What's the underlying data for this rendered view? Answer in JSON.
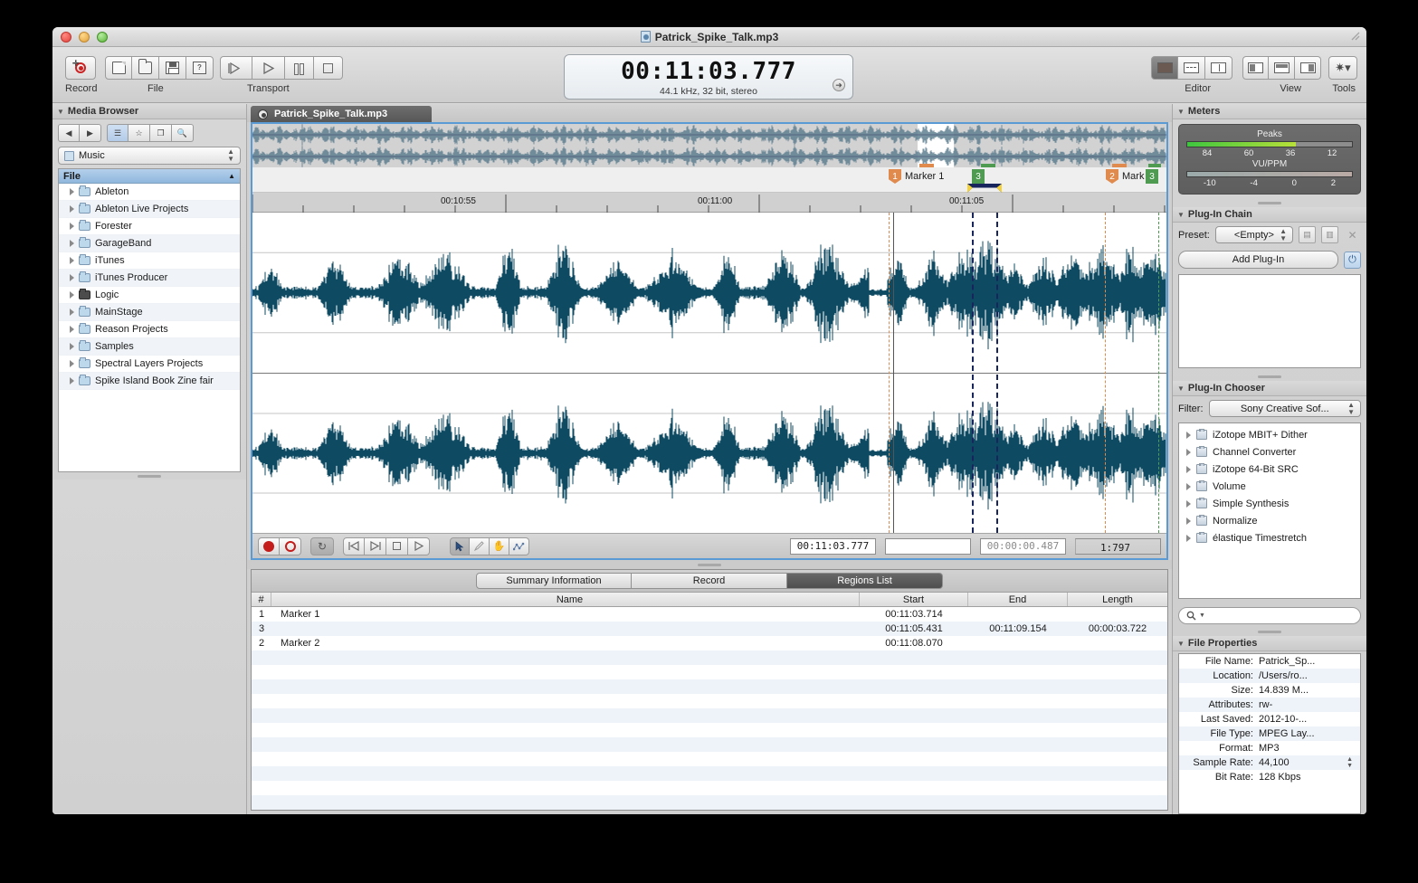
{
  "window": {
    "title": "Patrick_Spike_Talk.mp3"
  },
  "toolbar": {
    "groups": [
      {
        "label": "Record"
      },
      {
        "label": "File"
      },
      {
        "label": "Transport"
      },
      {
        "label": "Editor"
      },
      {
        "label": "View"
      },
      {
        "label": "Tools"
      }
    ],
    "record_label": "Record",
    "file_label": "File",
    "transport_label": "Transport",
    "editor_label": "Editor",
    "view_label": "View",
    "tools_label": "Tools"
  },
  "clock": {
    "time": "00:11:03.777",
    "format": "44.1 kHz, 32 bit, stereo"
  },
  "media_browser": {
    "title": "Media Browser",
    "path": "Music",
    "column_header": "File",
    "items": [
      {
        "label": "Ableton",
        "icon": "folder-icon"
      },
      {
        "label": "Ableton Live Projects",
        "icon": "folder-icon"
      },
      {
        "label": "Forester",
        "icon": "folder-icon"
      },
      {
        "label": "GarageBand",
        "icon": "folder-icon"
      },
      {
        "label": "iTunes",
        "icon": "folder-icon"
      },
      {
        "label": "iTunes Producer",
        "icon": "folder-icon"
      },
      {
        "label": "Logic",
        "icon": "folder-dark-icon"
      },
      {
        "label": "MainStage",
        "icon": "folder-icon"
      },
      {
        "label": "Reason Projects",
        "icon": "folder-icon"
      },
      {
        "label": "Samples",
        "icon": "folder-icon"
      },
      {
        "label": "Spectral Layers Projects",
        "icon": "folder-icon"
      },
      {
        "label": "Spike Island Book Zine fair",
        "icon": "folder-icon"
      }
    ]
  },
  "editor": {
    "tab_label": "Patrick_Spike_Talk.mp3",
    "ruler_labels": [
      "00:10:55",
      "00:11:00",
      "00:11:05"
    ],
    "markers": [
      {
        "number": "1",
        "label": "Marker 1",
        "color": "#e08a4e"
      },
      {
        "number": "3",
        "label": "",
        "color": "#4f9b52"
      },
      {
        "number": "2",
        "label": "Mark",
        "color": "#e08a4e"
      },
      {
        "number": "3",
        "label": "",
        "color": "#4f9b52"
      }
    ],
    "waveform_color": "#0f4a63"
  },
  "transport_fields": {
    "position": "00:11:03.777",
    "second": "",
    "selection": "00:00:00.487",
    "ratio": "1:797"
  },
  "bottom_tabs": [
    {
      "label": "Summary Information",
      "selected": false
    },
    {
      "label": "Record",
      "selected": false
    },
    {
      "label": "Regions List",
      "selected": true
    }
  ],
  "regions_list": {
    "columns": [
      "#",
      "Name",
      "Start",
      "End",
      "Length"
    ],
    "rows": [
      {
        "num": "1",
        "name": "Marker 1",
        "start": "00:11:03.714",
        "end": "",
        "length": ""
      },
      {
        "num": "3",
        "name": "",
        "start": "00:11:05.431",
        "end": "00:11:09.154",
        "length": "00:00:03.722"
      },
      {
        "num": "2",
        "name": "Marker 2",
        "start": "00:11:08.070",
        "end": "",
        "length": ""
      }
    ]
  },
  "meters": {
    "title": "Meters",
    "peaks_label": "Peaks",
    "peaks_ticks": [
      "84",
      "60",
      "36",
      "12"
    ],
    "vu_label": "VU/PPM",
    "vu_ticks": [
      "-10",
      "-4",
      "0",
      "2"
    ]
  },
  "plugin_chain": {
    "title": "Plug-In Chain",
    "preset_label": "Preset:",
    "preset_value": "<Empty>",
    "add_label": "Add Plug-In"
  },
  "plugin_chooser": {
    "title": "Plug-In Chooser",
    "filter_label": "Filter:",
    "filter_value": "Sony Creative Sof...",
    "items": [
      {
        "label": "iZotope MBIT+ Dither"
      },
      {
        "label": "Channel Converter"
      },
      {
        "label": "iZotope 64-Bit SRC"
      },
      {
        "label": "Volume"
      },
      {
        "label": "Simple Synthesis"
      },
      {
        "label": "Normalize"
      },
      {
        "label": "élastique Timestretch"
      }
    ]
  },
  "file_properties": {
    "title": "File Properties",
    "rows": [
      {
        "key": "File Name:",
        "value": "Patrick_Sp..."
      },
      {
        "key": "Location:",
        "value": "/Users/ro..."
      },
      {
        "key": "Size:",
        "value": "14.839 M..."
      },
      {
        "key": "Attributes:",
        "value": "rw-"
      },
      {
        "key": "Last Saved:",
        "value": "2012-10-..."
      },
      {
        "key": "File Type:",
        "value": "MPEG Lay..."
      },
      {
        "key": "Format:",
        "value": "MP3"
      },
      {
        "key": "Sample Rate:",
        "value": "44,100"
      },
      {
        "key": "Bit Rate:",
        "value": "128 Kbps"
      }
    ]
  }
}
